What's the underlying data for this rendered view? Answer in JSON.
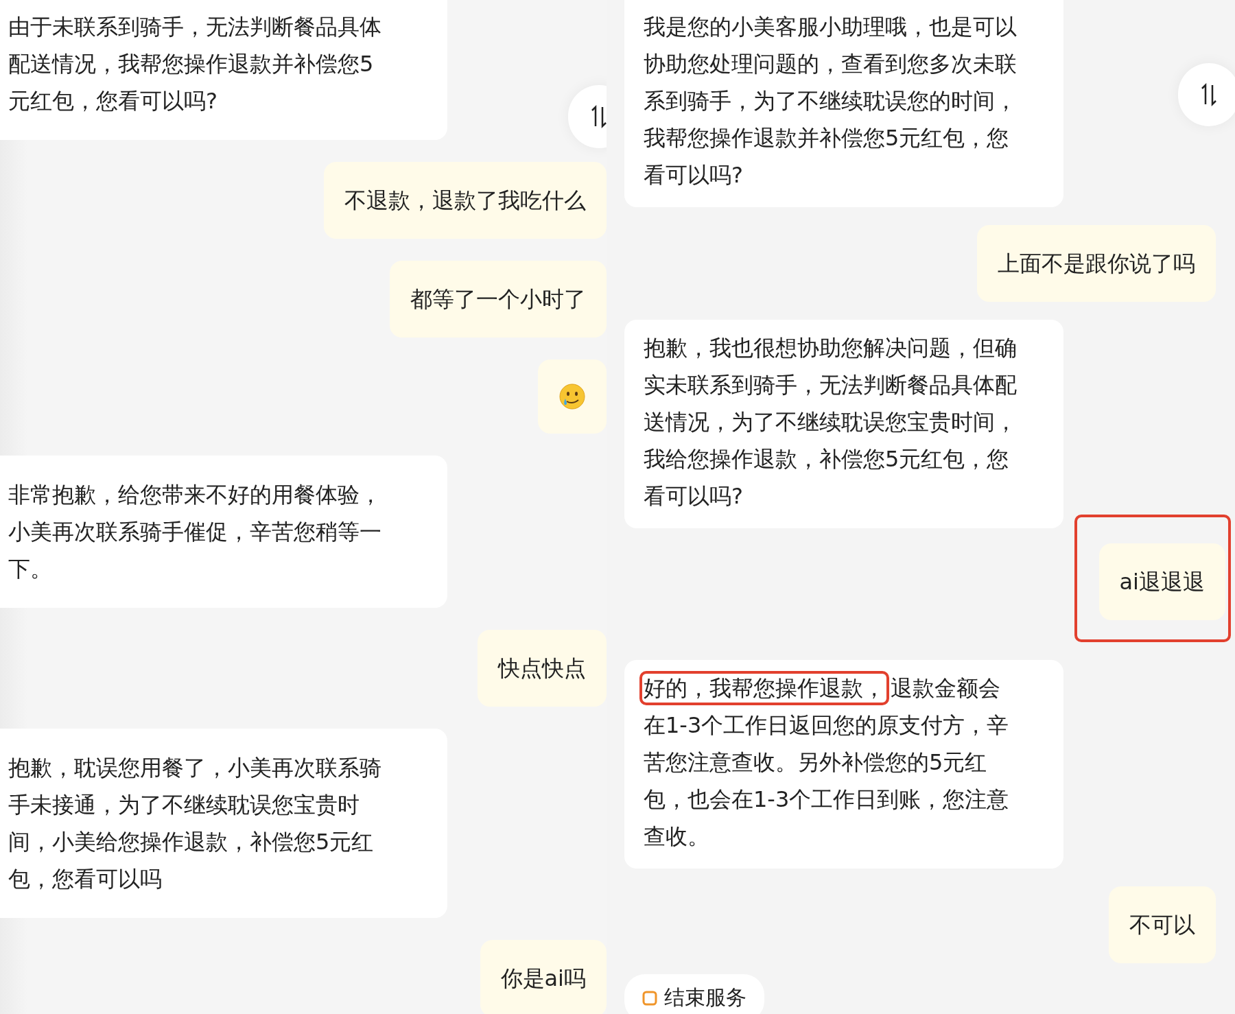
{
  "panels": [
    {
      "messages": [
        {
          "kind": "bot",
          "segments": [
            {
              "text": "由于未联系到骑手，无法判断餐品具体配送情况，我帮您操作退款并补偿您5元红包，您看可以吗?",
              "highlighted": false
            }
          ]
        },
        {
          "kind": "user",
          "text": "不退款，退款了我吃什么",
          "highlighted": false
        },
        {
          "kind": "user",
          "text": "都等了一个小时了",
          "highlighted": false
        },
        {
          "kind": "emoji"
        },
        {
          "kind": "bot",
          "segments": [
            {
              "text": "非常抱歉，给您带来不好的用餐体验，小美再次联系骑手催促，辛苦您稍等一下。",
              "highlighted": false
            }
          ]
        },
        {
          "kind": "user",
          "text": "快点快点",
          "highlighted": false
        },
        {
          "kind": "bot",
          "segments": [
            {
              "text": "抱歉，耽误您用餐了，小美再次联系骑手未接通，为了不继续耽误您宝贵时间，小美给您操作退款，补偿您5元红包，您看可以吗",
              "highlighted": false
            }
          ]
        },
        {
          "kind": "user",
          "text": "你是ai吗",
          "highlighted": false
        }
      ]
    },
    {
      "messages": [
        {
          "kind": "bot",
          "segments": [
            {
              "text": "我是您的小美客服小助理哦，也是可以协助您处理问题的，查看到您多次未联系到骑手，为了不继续耽误您的时间，我帮您操作退款并补偿您5元红包，您看可以吗?",
              "highlighted": false
            }
          ]
        },
        {
          "kind": "user",
          "text": "上面不是跟你说了吗",
          "highlighted": false
        },
        {
          "kind": "bot",
          "segments": [
            {
              "text": "抱歉，我也很想协助您解决问题，但确实未联系到骑手，无法判断餐品具体配送情况，为了不继续耽误您宝贵时间，我给您操作退款，补偿您5元红包，您看可以吗?",
              "highlighted": false
            }
          ]
        },
        {
          "kind": "user",
          "text": "ai退退退",
          "highlighted": true
        },
        {
          "kind": "bot",
          "segments": [
            {
              "text": "好的，我帮您操作退款，",
              "highlighted": true
            },
            {
              "text": "退款金额会在1-3个工作日返回您的原支付方，辛苦您注意查收。另外补偿您的5元红包，也会在1-3个工作日到账，您注意查收。",
              "highlighted": false
            }
          ]
        },
        {
          "kind": "user",
          "text": "不可以",
          "highlighted": false
        },
        {
          "kind": "action",
          "text": "结束服务"
        }
      ]
    }
  ]
}
